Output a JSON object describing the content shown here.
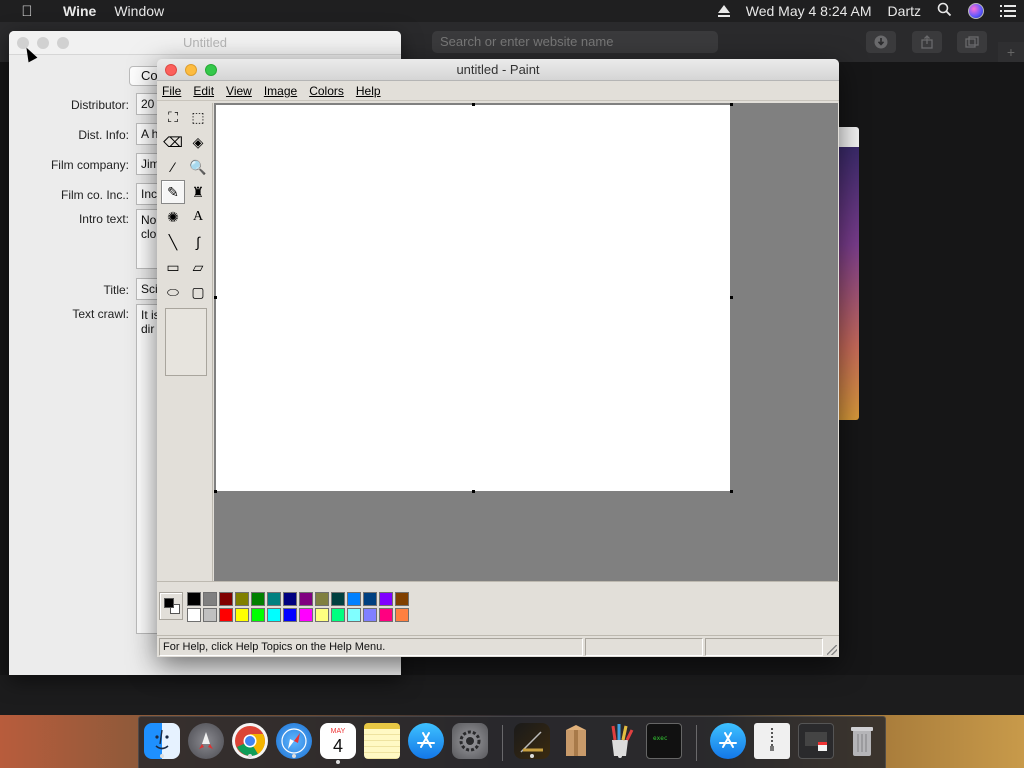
{
  "menubar": {
    "app_name": "Wine",
    "menu_window": "Window",
    "clock": "Wed May 4  8:24 AM",
    "user": "Dartz"
  },
  "browser": {
    "search_placeholder": "Search or enter website name",
    "new_tab": "+"
  },
  "form_window": {
    "title": "Untitled",
    "button_label": "Co",
    "fields": [
      {
        "label": "Distributor:",
        "value": "20"
      },
      {
        "label": "Dist. Info:",
        "value": "A h"
      },
      {
        "label": "Film company:",
        "value": "Jim"
      },
      {
        "label": "Film co. Inc.:",
        "value": "Inc"
      }
    ],
    "intro_label": "Intro text:",
    "intro_value": "No\nclo",
    "title_label": "Title:",
    "title_value": "Sci",
    "crawl_label": "Text crawl:",
    "crawl_value": "It is\ndir"
  },
  "paint": {
    "title": "untitled - Paint",
    "menu": {
      "file": "File",
      "edit": "Edit",
      "view": "View",
      "image": "Image",
      "colors": "Colors",
      "help": "Help"
    },
    "tools": [
      {
        "name": "free-form-select",
        "glyph": "⛶"
      },
      {
        "name": "select",
        "glyph": "⬚"
      },
      {
        "name": "eraser",
        "glyph": "⌫"
      },
      {
        "name": "fill-with-color",
        "glyph": "◈"
      },
      {
        "name": "pick-color",
        "glyph": "⁄"
      },
      {
        "name": "magnifier",
        "glyph": "🔍"
      },
      {
        "name": "pencil",
        "glyph": "✎"
      },
      {
        "name": "brush",
        "glyph": "♜"
      },
      {
        "name": "airbrush",
        "glyph": "✺"
      },
      {
        "name": "text",
        "glyph": "A"
      },
      {
        "name": "line",
        "glyph": "╲"
      },
      {
        "name": "curve",
        "glyph": "∫"
      },
      {
        "name": "rectangle",
        "glyph": "▭"
      },
      {
        "name": "polygon",
        "glyph": "⏥"
      },
      {
        "name": "ellipse",
        "glyph": "⬭"
      },
      {
        "name": "rounded-rectangle",
        "glyph": "▢"
      }
    ],
    "active_tool": "pencil",
    "palette_top": [
      "#000000",
      "#808080",
      "#800000",
      "#808000",
      "#008000",
      "#008080",
      "#000080",
      "#800080",
      "#808040",
      "#004040",
      "#0080ff",
      "#004080",
      "#8000ff",
      "#804000"
    ],
    "palette_bottom": [
      "#ffffff",
      "#c0c0c0",
      "#ff0000",
      "#ffff00",
      "#00ff00",
      "#00ffff",
      "#0000ff",
      "#ff00ff",
      "#ffff80",
      "#00ff80",
      "#80ffff",
      "#8080ff",
      "#ff0080",
      "#ff8040"
    ],
    "status_text": "For Help, click Help Topics on the Help Menu."
  },
  "dock": {
    "calendar_month": "MAY",
    "calendar_day": "4"
  }
}
